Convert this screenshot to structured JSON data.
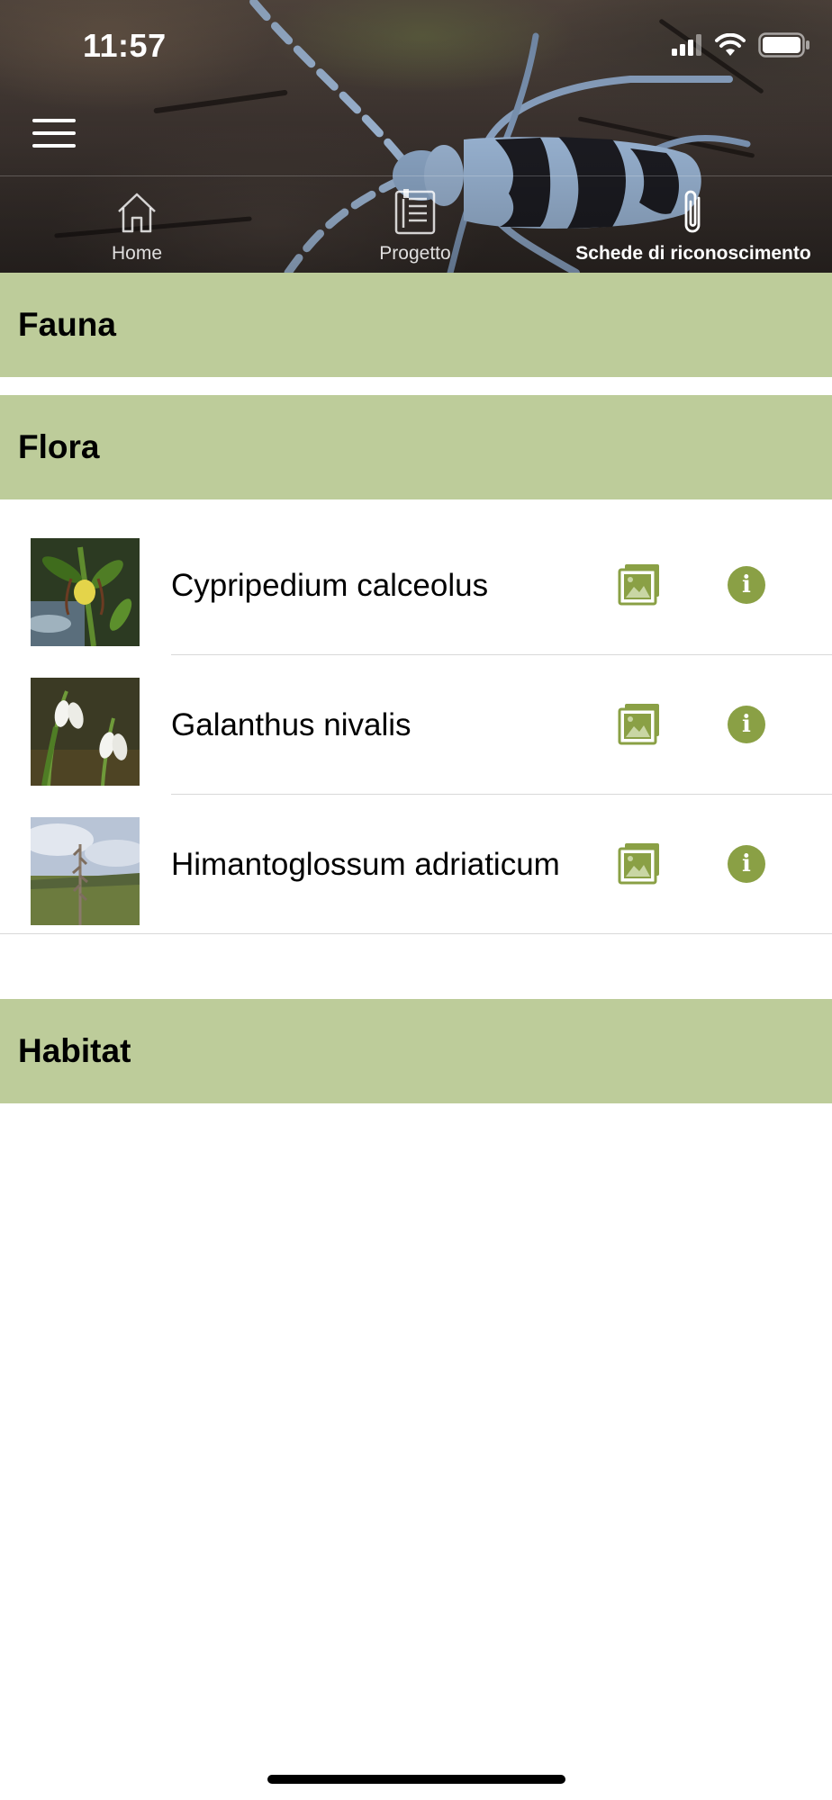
{
  "status_bar": {
    "time": "11:57",
    "icons": [
      "signal-icon",
      "wifi-icon",
      "battery-icon"
    ]
  },
  "header": {
    "background_image": "alpine-longhorn-beetle-on-bark",
    "menu_icon": "hamburger-menu-icon",
    "tabs": [
      {
        "label": "Home",
        "icon": "house-icon",
        "active": false
      },
      {
        "label": "Progetto",
        "icon": "document-icon",
        "active": false
      },
      {
        "label": "Schede di riconoscimento",
        "icon": "paperclip-icon",
        "active": true
      }
    ]
  },
  "sections": {
    "fauna": {
      "title": "Fauna"
    },
    "flora": {
      "title": "Flora",
      "items": [
        {
          "name": "Cypripedium calceolus",
          "thumbnail": "yellow-ladys-slipper-orchid-photo"
        },
        {
          "name": "Galanthus nivalis",
          "thumbnail": "snowdrop-flowers-photo"
        },
        {
          "name": "Himantoglossum adriaticum",
          "thumbnail": "lizard-orchid-meadow-photo"
        }
      ]
    },
    "habitat": {
      "title": "Habitat"
    }
  },
  "colors": {
    "section_header_bg": "#bdcc9a",
    "accent_green": "#8aa045",
    "row_divider": "#d9d9d9"
  }
}
